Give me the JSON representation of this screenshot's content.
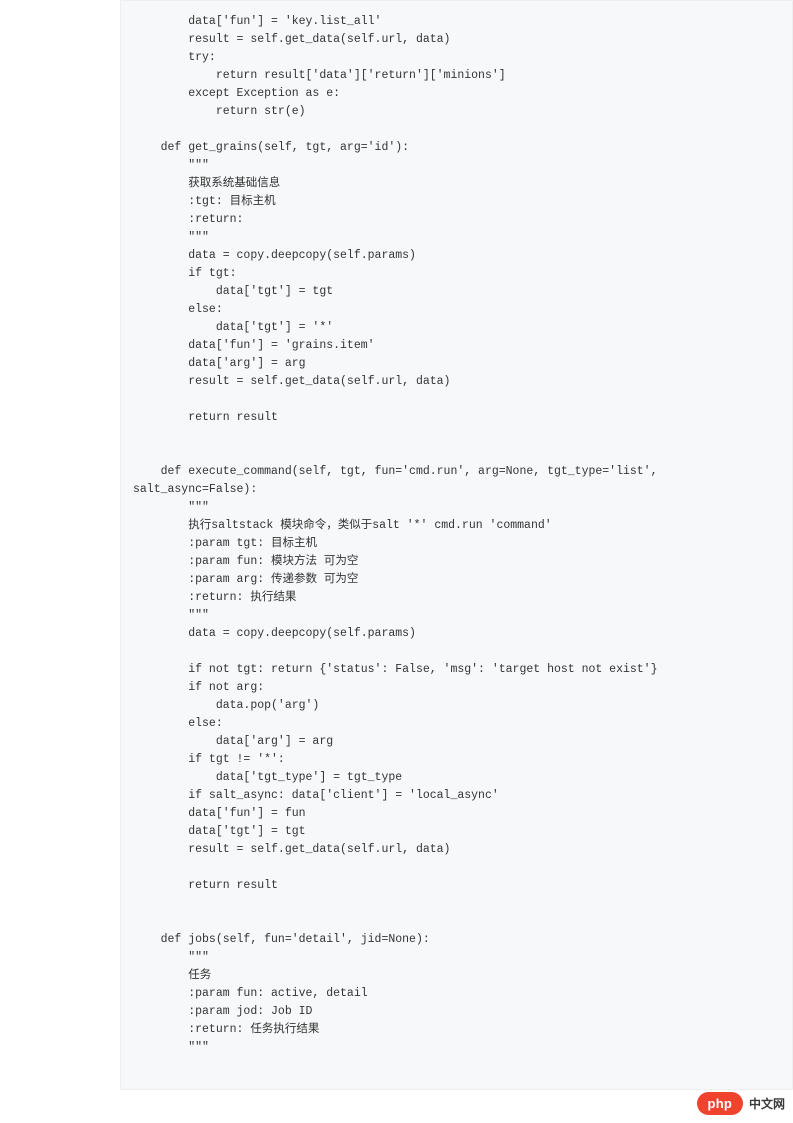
{
  "code": "        data['fun'] = 'key.list_all'\n        result = self.get_data(self.url, data)\n        try:\n            return result['data']['return']['minions']\n        except Exception as e:\n            return str(e)\n\n    def get_grains(self, tgt, arg='id'):\n        \"\"\"\n        获取系统基础信息\n        :tgt: 目标主机\n        :return:\n        \"\"\"\n        data = copy.deepcopy(self.params)\n        if tgt:\n            data['tgt'] = tgt\n        else:\n            data['tgt'] = '*'\n        data['fun'] = 'grains.item'\n        data['arg'] = arg\n        result = self.get_data(self.url, data)\n\n        return result\n\n\n    def execute_command(self, tgt, fun='cmd.run', arg=None, tgt_type='list', \nsalt_async=False):\n        \"\"\"\n        执行saltstack 模块命令，类似于salt '*' cmd.run 'command'\n        :param tgt: 目标主机\n        :param fun: 模块方法 可为空\n        :param arg: 传递参数 可为空\n        :return: 执行结果\n        \"\"\"\n        data = copy.deepcopy(self.params)\n\n        if not tgt: return {'status': False, 'msg': 'target host not exist'}\n        if not arg:\n            data.pop('arg')\n        else:\n            data['arg'] = arg\n        if tgt != '*':\n            data['tgt_type'] = tgt_type\n        if salt_async: data['client'] = 'local_async'\n        data['fun'] = fun\n        data['tgt'] = tgt\n        result = self.get_data(self.url, data)\n\n        return result\n\n\n    def jobs(self, fun='detail', jid=None):\n        \"\"\"\n        任务\n        :param fun: active, detail\n        :param jod: Job ID\n        :return: 任务执行结果\n        \"\"\"",
  "badge": {
    "pill": "php",
    "text": "中文网"
  }
}
